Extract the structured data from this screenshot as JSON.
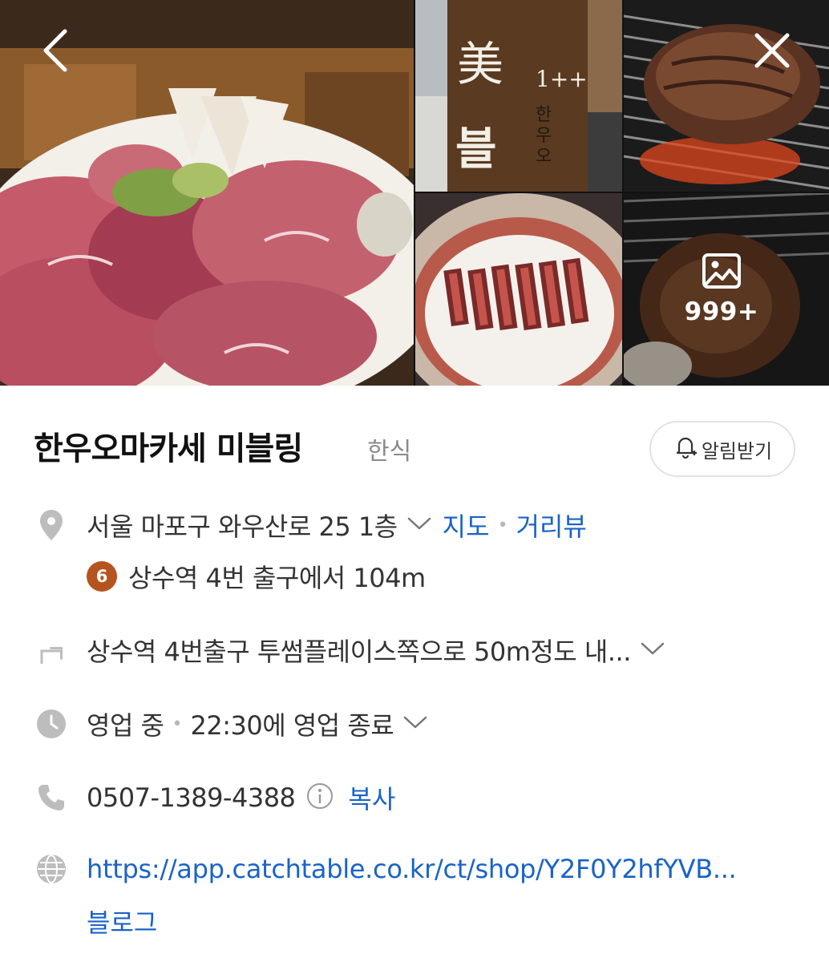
{
  "gallery": {
    "main_photo": "grilled hanwoo beef platter with mushrooms and zucchini",
    "sign_photo": {
      "hanja": "美",
      "grade": "1++",
      "hangul_big": "블",
      "hangul_vertical": "한우오"
    },
    "more_count": "999+",
    "back_icon": "chevron-left-icon",
    "close_icon": "close-icon",
    "gallery_icon": "image-icon"
  },
  "place": {
    "name": "한우오마카세 미블링",
    "category": "한식",
    "notify_label": "알림받기"
  },
  "address": {
    "text": "서울 마포구 와우산로 25 1층",
    "map_label": "지도",
    "street_view_label": "거리뷰"
  },
  "subway": {
    "line": "6",
    "line_color": "#b5541f",
    "text": "상수역 4번 출구에서 104m"
  },
  "direction": {
    "text": "상수역 4번출구 투썸플레이스쪽으로 50m정도 내..."
  },
  "hours": {
    "status": "영업 중",
    "detail": "22:30에 영업 종료"
  },
  "phone": {
    "number": "0507-1389-4388",
    "copy_label": "복사"
  },
  "website": {
    "url": "https://app.catchtable.co.kr/ct/shop/Y2F0Y2hfYVB...",
    "blog_label": "블로그"
  },
  "colors": {
    "link": "#1a63c9",
    "icon_gray": "#bdbdbd"
  }
}
